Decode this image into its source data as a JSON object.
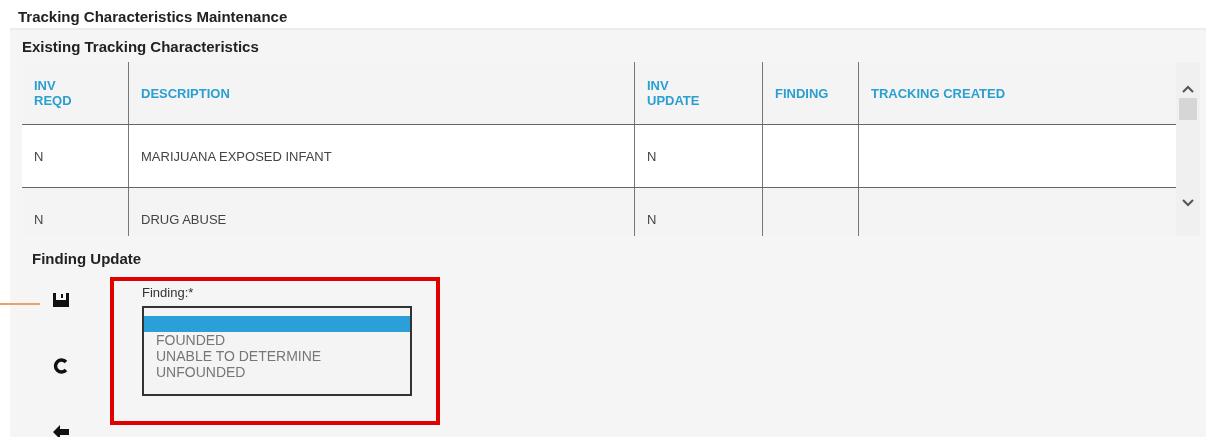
{
  "page": {
    "title": "Tracking Characteristics Maintenance"
  },
  "existing": {
    "title": "Existing Tracking Characteristics",
    "columns": [
      {
        "lines": [
          "INV",
          "REQD"
        ]
      },
      {
        "lines": [
          "DESCRIPTION"
        ]
      },
      {
        "lines": [
          "INV",
          "UPDATE"
        ]
      },
      {
        "lines": [
          "FINDING"
        ]
      },
      {
        "lines": [
          "TRACKING CREATED"
        ]
      }
    ],
    "rows": [
      {
        "cells": [
          "N",
          "MARIJUANA EXPOSED INFANT",
          "N",
          null,
          null
        ]
      },
      {
        "cells": [
          "N",
          "DRUG ABUSE",
          "N",
          null,
          null
        ]
      }
    ]
  },
  "finding_update": {
    "title": "Finding Update",
    "field_label": "Finding:*",
    "options": [
      {
        "selected": true
      },
      {
        "label": "FOUNDED",
        "selected": false
      },
      {
        "label": "UNABLE TO DETERMINE",
        "selected": false
      },
      {
        "label": "UNFOUNDED",
        "selected": false
      }
    ]
  }
}
